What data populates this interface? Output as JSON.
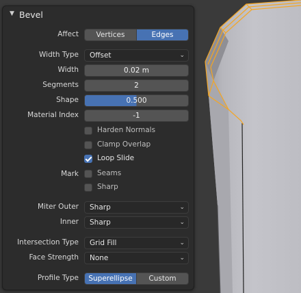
{
  "panel": {
    "title": "Bevel",
    "affect": {
      "label": "Affect",
      "options": [
        "Vertices",
        "Edges"
      ],
      "selected": "Edges"
    },
    "width_type": {
      "label": "Width Type",
      "value": "Offset"
    },
    "width": {
      "label": "Width",
      "value": "0.02 m"
    },
    "segments": {
      "label": "Segments",
      "value": "2"
    },
    "shape": {
      "label": "Shape",
      "value": "0.500",
      "fraction": 0.5
    },
    "material_index": {
      "label": "Material Index",
      "value": "-1"
    },
    "harden_normals": {
      "label": "Harden Normals",
      "checked": false
    },
    "clamp_overlap": {
      "label": "Clamp Overlap",
      "checked": false
    },
    "loop_slide": {
      "label": "Loop Slide",
      "checked": true
    },
    "mark": {
      "label": "Mark"
    },
    "seams": {
      "label": "Seams",
      "checked": false
    },
    "sharp": {
      "label": "Sharp",
      "checked": false
    },
    "miter_outer": {
      "label": "Miter Outer",
      "value": "Sharp"
    },
    "inner": {
      "label": "Inner",
      "value": "Sharp"
    },
    "intersection_type": {
      "label": "Intersection Type",
      "value": "Grid Fill"
    },
    "face_strength": {
      "label": "Face Strength",
      "value": "None"
    },
    "profile_type": {
      "label": "Profile Type",
      "options": [
        "Superellipse",
        "Custom"
      ],
      "selected": "Superellipse"
    }
  },
  "colors": {
    "accent": "#4772b3",
    "panel_bg": "#2c2c2c",
    "viewport_bg": "#3a3a3a",
    "selection_edge": "#f5a623"
  },
  "icons": {
    "collapse": "triangle-down-icon",
    "dropdown": "chevron-down-icon",
    "check": "checkmark-icon"
  }
}
